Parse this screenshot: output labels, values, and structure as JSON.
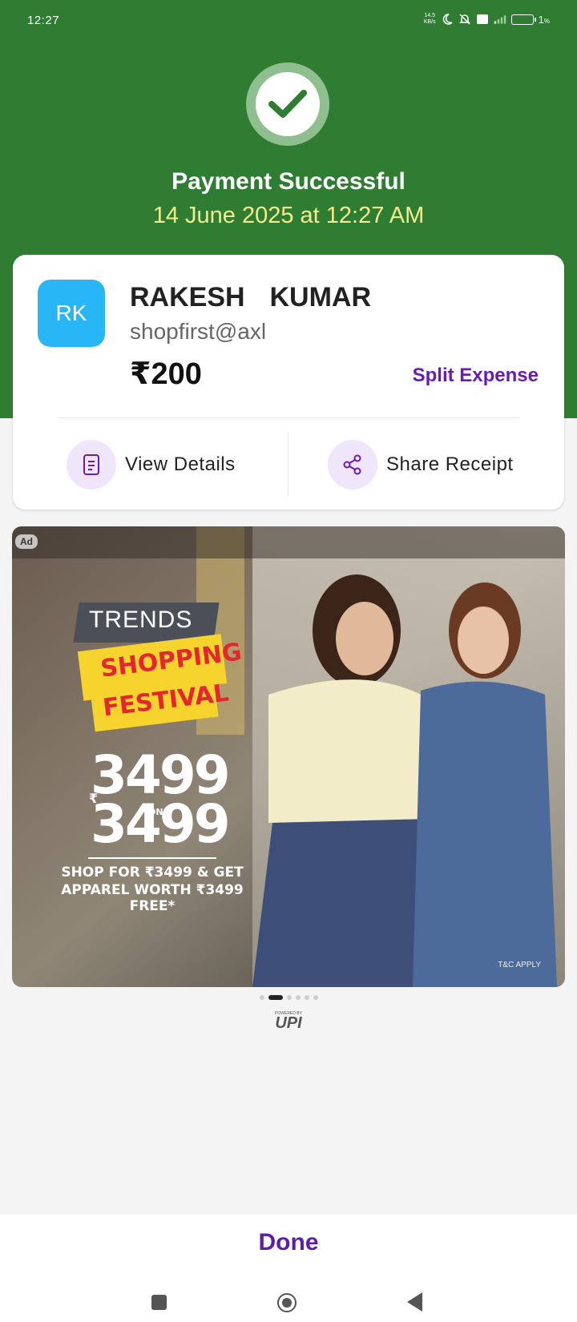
{
  "status_bar": {
    "time": "12:27",
    "net_speed_value": "14.5",
    "net_speed_unit": "KB/s",
    "battery": "1",
    "battery_unit": "%",
    "icons": [
      "moon-icon",
      "mute-bell-icon",
      "volte-icon",
      "4g-icon",
      "signal-icon",
      "battery-icon"
    ]
  },
  "header": {
    "title": "Payment Successful",
    "datetime": "14 June 2025 at 12:27 AM",
    "icon": "check-circle-icon",
    "colors": {
      "background": "#2e7d32",
      "date_text": "#f4ed8f"
    }
  },
  "receipt": {
    "avatar_initials": "RK",
    "payee_name": "RAKESH  KUMAR",
    "payee_upi": "shopfirst@axl",
    "amount": "₹200",
    "split_label": "Split Expense",
    "actions": [
      {
        "label": "View Details",
        "icon": "document-icon"
      },
      {
        "label": "Share Receipt",
        "icon": "share-icon"
      }
    ],
    "colors": {
      "avatar": "#29b6f6",
      "accent": "#6a1bb0"
    }
  },
  "ad": {
    "badge": "Ad",
    "brand": "TRENDS",
    "line1": "SHOPPING",
    "line2": "FESTIVAL",
    "big_top": "3499",
    "currency": "₹",
    "on": "ON",
    "big_bottom": "3499",
    "copy_line1": "SHOP FOR ₹3499 & GET",
    "copy_line2": "APPAREL WORTH ₹3499 FREE*",
    "tc": "T&C APPLY",
    "carousel": {
      "count": 6,
      "active_index": 1
    }
  },
  "upi": {
    "powered_by": "POWERED BY",
    "name": "UPI"
  },
  "footer": {
    "done_label": "Done"
  },
  "nav": {
    "buttons": [
      "recents-button",
      "home-button",
      "back-button"
    ]
  }
}
